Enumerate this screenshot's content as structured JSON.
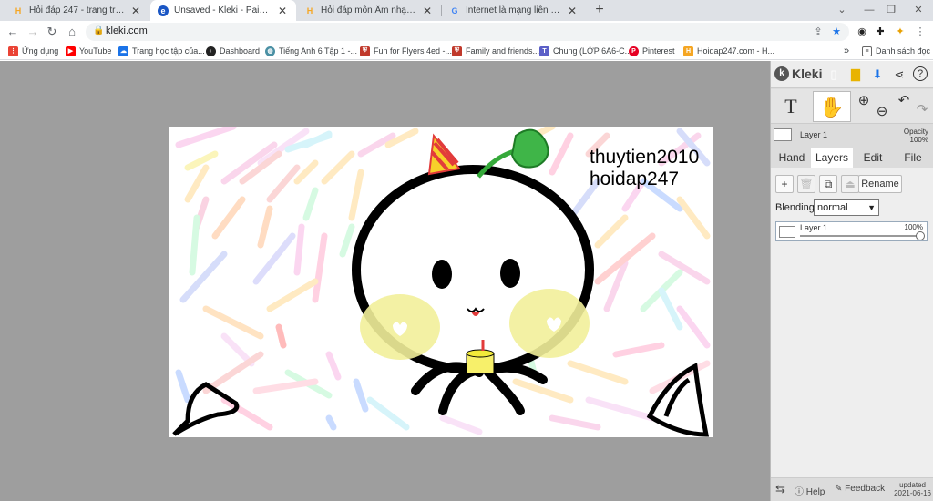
{
  "browser": {
    "tabs": [
      {
        "title": "Hỏi đáp 247 - trang tra loi",
        "icon": "hoidap-favicon",
        "active": false
      },
      {
        "title": "Unsaved - Kleki - Paint Tool",
        "icon": "kleki-favicon",
        "active": true
      },
      {
        "title": "Hỏi đáp môn Âm nhạc, Mỹ thuật",
        "icon": "hoidap-favicon",
        "active": false
      },
      {
        "title": "Internet là mạng liên kết A. các m",
        "icon": "google-favicon",
        "active": false
      }
    ],
    "new_tab": "+",
    "window_controls": {
      "collapse": "⌄",
      "minimize": "—",
      "restore": "❐",
      "close": "✕"
    },
    "url": "kleki.com",
    "bookmarks": [
      {
        "label": "Ứng dụng",
        "icon": "apps-icon",
        "color": "#ea4335"
      },
      {
        "label": "YouTube",
        "icon": "youtube-icon",
        "color": "#ff0000"
      },
      {
        "label": "Trang học tập của...",
        "icon": "onedrive-icon",
        "color": "#1a73e8"
      },
      {
        "label": "Dashboard",
        "icon": "dashboard-icon",
        "color": "#222222"
      },
      {
        "label": "Tiếng Anh 6 Tập 1 -...",
        "icon": "globe-icon",
        "color": "#4a90a4"
      },
      {
        "label": "Fun for Flyers 4ed -...",
        "icon": "shield-icon",
        "color": "#c0392b"
      },
      {
        "label": "Family and friends...",
        "icon": "shield-icon",
        "color": "#c0392b"
      },
      {
        "label": "Chung (LỚP 6A6-C...",
        "icon": "teams-icon",
        "color": "#5b5fc7"
      },
      {
        "label": "Pinterest",
        "icon": "pinterest-icon",
        "color": "#e60023"
      },
      {
        "label": "Hoidap247.com - H...",
        "icon": "hoidap-favicon",
        "color": "#f5a623"
      }
    ],
    "bookmarks_more": "»",
    "reading_list": "Danh sách đọc"
  },
  "canvas": {
    "text_line1": "thuytien2010",
    "text_line2": "hoidap247"
  },
  "kleki": {
    "logo": "Kleki",
    "tools": {
      "text": "T",
      "hand": "✋",
      "zoom_in": "⊕",
      "zoom_out": "⊖",
      "undo": "↶",
      "redo": "↷"
    },
    "layer_info": {
      "name": "Layer 1",
      "opacity_label": "Opacity",
      "opacity_value": "100%"
    },
    "tabs": [
      "Hand",
      "Layers",
      "Edit",
      "File"
    ],
    "active_tab": "Layers",
    "layer_buttons": {
      "add": "+",
      "delete": "🗑",
      "duplicate": "⧉",
      "merge": "⏏",
      "rename": "Rename"
    },
    "blending_label": "Blending",
    "blending_value": "normal",
    "layers": [
      {
        "name": "Layer 1",
        "opacity": "100%",
        "opacity_fraction": 1.0
      }
    ],
    "footer": {
      "swap": "⇆",
      "help": "Help",
      "feedback": "Feedback",
      "updated_label": "updated",
      "updated_date": "2021-06-16"
    }
  }
}
